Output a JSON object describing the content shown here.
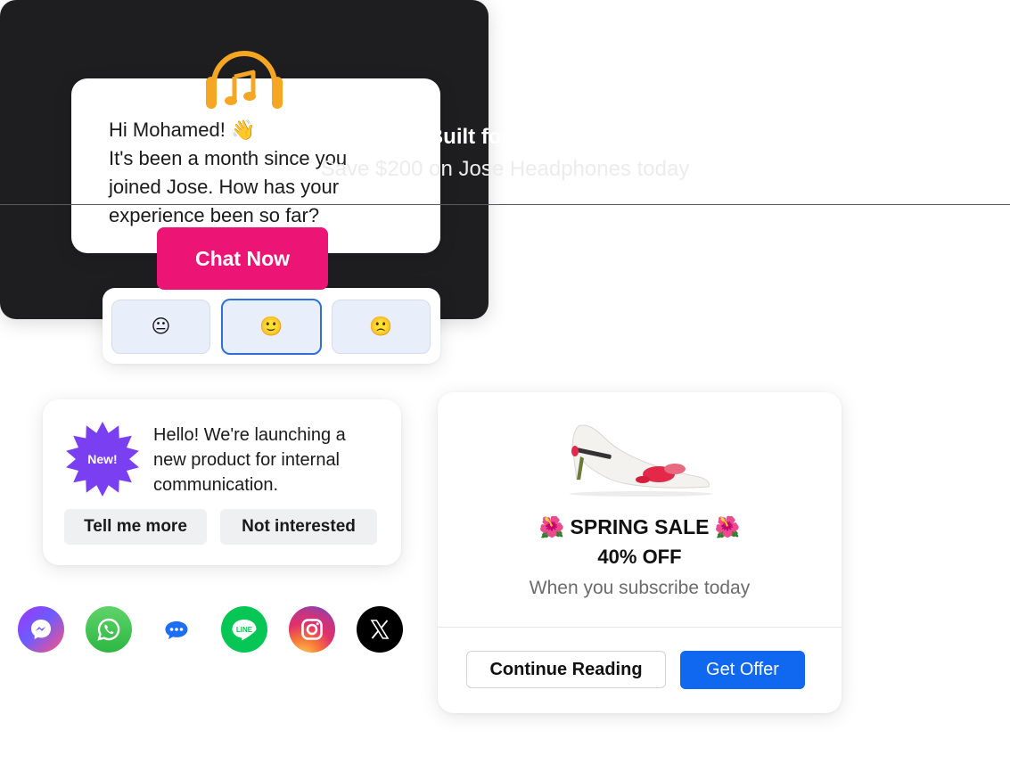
{
  "greeting": {
    "line1": "Hi Mohamed! 👋",
    "line2": "It's been a month since you",
    "line3": "joined Jose. How has your",
    "line4": "experience been so far?"
  },
  "rating": {
    "options": [
      {
        "emoji": "😐",
        "name": "neutral-face"
      },
      {
        "emoji": "🙂",
        "name": "slightly-smiling-face",
        "selected": true
      },
      {
        "emoji": "🙁",
        "name": "frowning-face"
      }
    ]
  },
  "promo": {
    "icon": "headphones-music-icon",
    "title": "Built for Sound",
    "subtitle": "Save $200 on Jose Headphones today",
    "button_label": "Chat Now",
    "accent": "#ec1475",
    "icon_color": "#f5a623"
  },
  "launch": {
    "badge_label": "New!",
    "badge_color": "#7b3ff2",
    "line1": "Hello! We're launching a",
    "line2": "new product for internal",
    "line3": "communication.",
    "button_primary": "Tell me more",
    "button_secondary": "Not interested"
  },
  "social": [
    {
      "name": "messenger-icon"
    },
    {
      "name": "whatsapp-icon"
    },
    {
      "name": "chat-bubble-icon"
    },
    {
      "name": "line-icon",
      "label": "LINE"
    },
    {
      "name": "instagram-icon"
    },
    {
      "name": "x-icon"
    }
  ],
  "sale": {
    "title": "🌺  SPRING SALE  🌺",
    "discount": "40% OFF",
    "subtitle": "When you subscribe today",
    "button_secondary": "Continue Reading",
    "button_primary": "Get Offer",
    "accent": "#1067f0"
  }
}
